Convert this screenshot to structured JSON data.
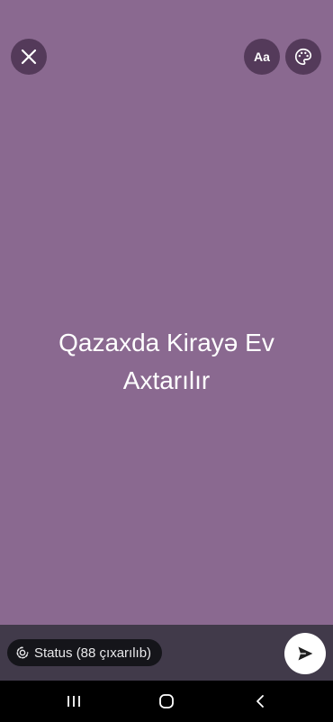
{
  "composer": {
    "text": "Qazaxda Kirayə Ev Axtarılır",
    "font_button_label": "Aa",
    "background_color": "#8a6990"
  },
  "icons": {
    "close": "close-icon",
    "palette": "palette-icon",
    "privacy": "status-privacy-icon",
    "send": "send-icon"
  },
  "footer": {
    "privacy_label": "Status (88 çıxarılıb)"
  },
  "navbar": {
    "recents": "recents-icon",
    "home": "home-icon",
    "back": "back-icon"
  }
}
